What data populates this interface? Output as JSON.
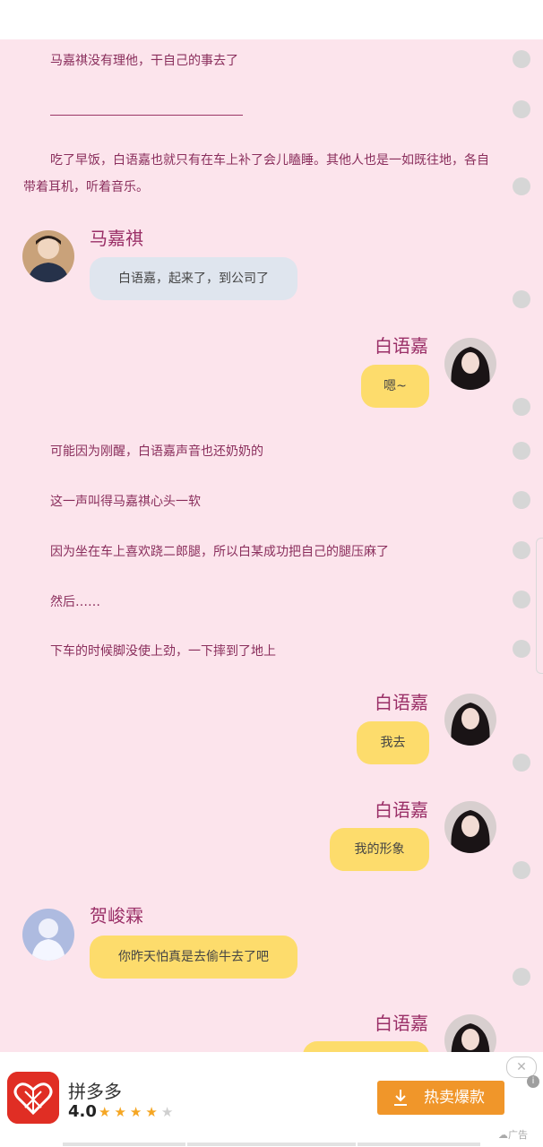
{
  "story": {
    "p1": "马嘉祺没有理他，干自己的事去了",
    "p2": "吃了早饭，白语嘉也就只有在车上补了会儿瞌睡。其他人也是一如既往地，各自带着耳机，听着音乐。",
    "p3": "可能因为刚醒，白语嘉声音也还奶奶的",
    "p4": "这一声叫得马嘉祺心头一软",
    "p5": "因为坐在车上喜欢跷二郎腿，所以白某成功把自己的腿压麻了",
    "p6": "然后……",
    "p7": "下车的时候脚没使上劲，一下摔到了地上"
  },
  "chat": [
    {
      "speaker": "马嘉祺",
      "text": "白语嘉，起来了，到公司了",
      "side": "left",
      "color": "gray"
    },
    {
      "speaker": "白语嘉",
      "text": "嗯~",
      "side": "right",
      "color": "yellow"
    },
    {
      "speaker": "白语嘉",
      "text": "我去",
      "side": "right",
      "color": "yellow"
    },
    {
      "speaker": "白语嘉",
      "text": "我的形象",
      "side": "right",
      "color": "yellow"
    },
    {
      "speaker": "贺峻霖",
      "text": "你昨天怕真是去偷牛去了吧",
      "side": "left",
      "color": "yellow"
    },
    {
      "speaker": "白语嘉",
      "text": "",
      "side": "right",
      "color": "yellow"
    }
  ],
  "ad": {
    "app_name": "拼多多",
    "rating": "4.0",
    "stars_filled": 4,
    "stars_total": 5,
    "button_label": "热卖爆款",
    "close_glyph": "✕",
    "info_glyph": "i",
    "label": "广告",
    "label_icon": "cloud-icon"
  },
  "colors": {
    "background": "#fce4ec",
    "text": "#8a2e5c",
    "bubble_yellow": "#fddc6c",
    "bubble_gray": "#dfe5ee",
    "ad_button": "#f0962a",
    "ad_logo": "#e02e24"
  }
}
